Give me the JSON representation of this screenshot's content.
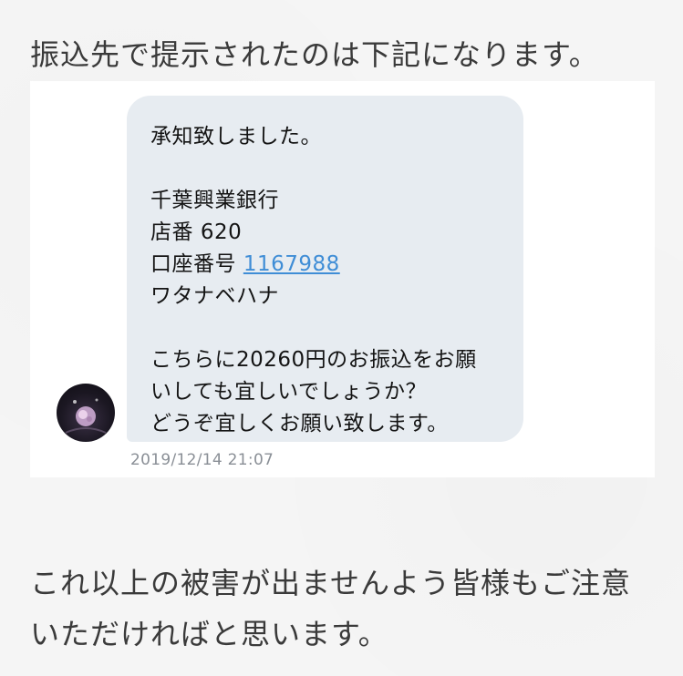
{
  "intro_text": "振込先で提示されたのは下記になります。",
  "message": {
    "line1": "承知致しました。",
    "bank_name": "千葉興業銀行",
    "branch_label": "店番",
    "branch_number": "620",
    "account_label": "口座番号",
    "account_number": "1167988",
    "account_holder": "ワタナベハナ",
    "request_line1": "こちらに20260円のお振込をお願",
    "request_line2": "いしても宜しいでしょうか？",
    "closing": "どうぞ宜しくお願い致します。",
    "timestamp": "2019/12/14 21:07"
  },
  "outro_line1": "これ以上の被害が出ませんよう皆様もご注意",
  "outro_line2": "いただければと思います。",
  "colors": {
    "bubble": "#e7ecf1",
    "link": "#3f8dd6",
    "timestamp": "#8a8f96"
  }
}
